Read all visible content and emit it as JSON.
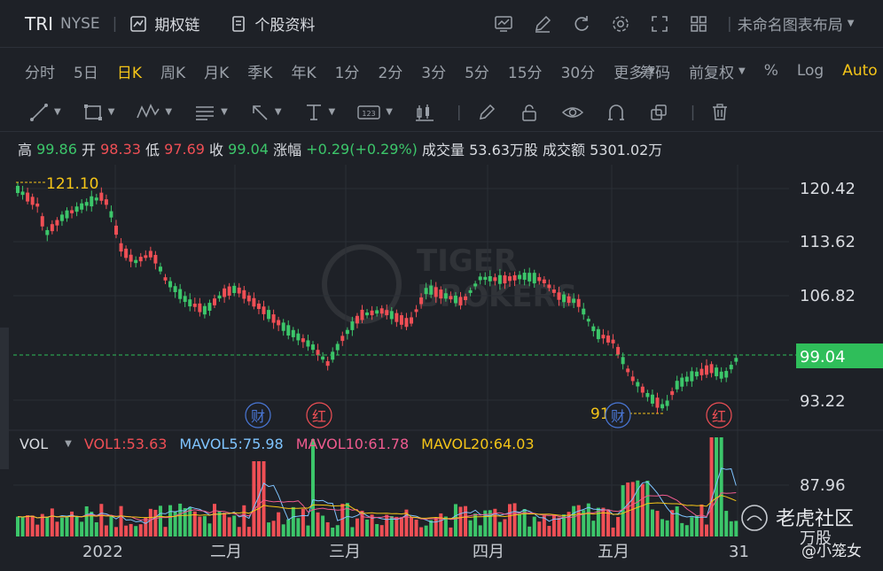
{
  "header": {
    "ticker": "TRI",
    "exchange": "NYSE",
    "option_chain_label": "期权链",
    "profile_label": "个股资料",
    "layout_label": "未命名图表布局"
  },
  "periods": [
    "分时",
    "5日",
    "日K",
    "周K",
    "月K",
    "季K",
    "年K",
    "1分",
    "2分",
    "3分",
    "5分",
    "15分",
    "30分",
    "更多"
  ],
  "active_period": "日K",
  "right_options": {
    "chip": "筹码",
    "adjust": "前复权",
    "percent": "%",
    "log": "Log",
    "auto": "Auto"
  },
  "ohlc": {
    "high_label": "高",
    "high": "99.86",
    "open_label": "开",
    "open": "98.33",
    "low_label": "低",
    "low": "97.69",
    "close_label": "收",
    "close": "99.04",
    "change_label": "涨幅",
    "change": "+0.29(+0.29%)",
    "volume_label": "成交量",
    "volume": "53.63万股",
    "turnover_label": "成交额",
    "turnover": "5301.02万"
  },
  "chart_data": {
    "type": "candlestick",
    "price_axis_ticks": [
      "120.42",
      "113.62",
      "106.82",
      "99.04",
      "93.22"
    ],
    "current_price": "99.04",
    "max_marker": "121.10",
    "min_marker": "91",
    "x_labels": [
      "2022",
      "二月",
      "三月",
      "四月",
      "五月",
      "31"
    ],
    "event_markers": [
      "财",
      "红",
      "财",
      "红"
    ],
    "volume_axis_ticks": [
      "87.96",
      "万股"
    ]
  },
  "volume": {
    "label": "VOL",
    "vol1": "VOL1:53.63",
    "mavol5": "MAVOL5:75.98",
    "mavol10": "MAVOL10:61.78",
    "mavol20": "MAVOL20:64.03"
  },
  "watermark": {
    "brand": "老虎社区",
    "user": "@小笼女"
  },
  "colors": {
    "up": "#3cc66a",
    "down": "#ef4f55",
    "accent": "#f5c518",
    "current": "#2fbe5a",
    "bg": "#1e2127"
  }
}
